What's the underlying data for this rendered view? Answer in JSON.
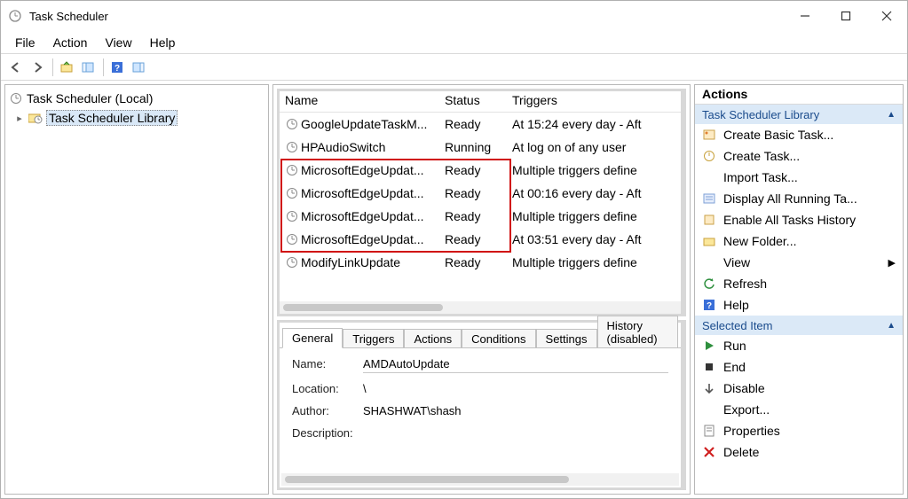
{
  "window": {
    "title": "Task Scheduler"
  },
  "menu": {
    "file": "File",
    "action": "Action",
    "view": "View",
    "help": "Help"
  },
  "tree": {
    "root": "Task Scheduler (Local)",
    "lib": "Task Scheduler Library"
  },
  "columns": {
    "name": "Name",
    "status": "Status",
    "triggers": "Triggers"
  },
  "tasks": [
    {
      "name": "GoogleUpdateTaskM...",
      "status": "Ready",
      "trigger": "At 15:24 every day - Aft"
    },
    {
      "name": "HPAudioSwitch",
      "status": "Running",
      "trigger": "At log on of any user"
    },
    {
      "name": "MicrosoftEdgeUpdat...",
      "status": "Ready",
      "trigger": "Multiple triggers define"
    },
    {
      "name": "MicrosoftEdgeUpdat...",
      "status": "Ready",
      "trigger": "At 00:16 every day - Aft"
    },
    {
      "name": "MicrosoftEdgeUpdat...",
      "status": "Ready",
      "trigger": "Multiple triggers define"
    },
    {
      "name": "MicrosoftEdgeUpdat...",
      "status": "Ready",
      "trigger": "At 03:51 every day - Aft"
    },
    {
      "name": "ModifyLinkUpdate",
      "status": "Ready",
      "trigger": "Multiple triggers define"
    }
  ],
  "detail": {
    "tabs": {
      "general": "General",
      "triggers": "Triggers",
      "actions": "Actions",
      "conditions": "Conditions",
      "settings": "Settings",
      "history": "History (disabled)"
    },
    "labels": {
      "name": "Name:",
      "location": "Location:",
      "author": "Author:",
      "description": "Description:"
    },
    "values": {
      "name": "AMDAutoUpdate",
      "location": "\\",
      "author": "SHASHWAT\\shash",
      "description": ""
    }
  },
  "actions": {
    "title": "Actions",
    "group1": "Task Scheduler Library",
    "items1": {
      "createBasic": "Create Basic Task...",
      "create": "Create Task...",
      "import": "Import Task...",
      "displayRunning": "Display All Running Ta...",
      "enableHistory": "Enable All Tasks History",
      "newFolder": "New Folder...",
      "view": "View",
      "refresh": "Refresh",
      "help": "Help"
    },
    "group2": "Selected Item",
    "items2": {
      "run": "Run",
      "end": "End",
      "disable": "Disable",
      "export": "Export...",
      "properties": "Properties",
      "delete": "Delete"
    }
  }
}
